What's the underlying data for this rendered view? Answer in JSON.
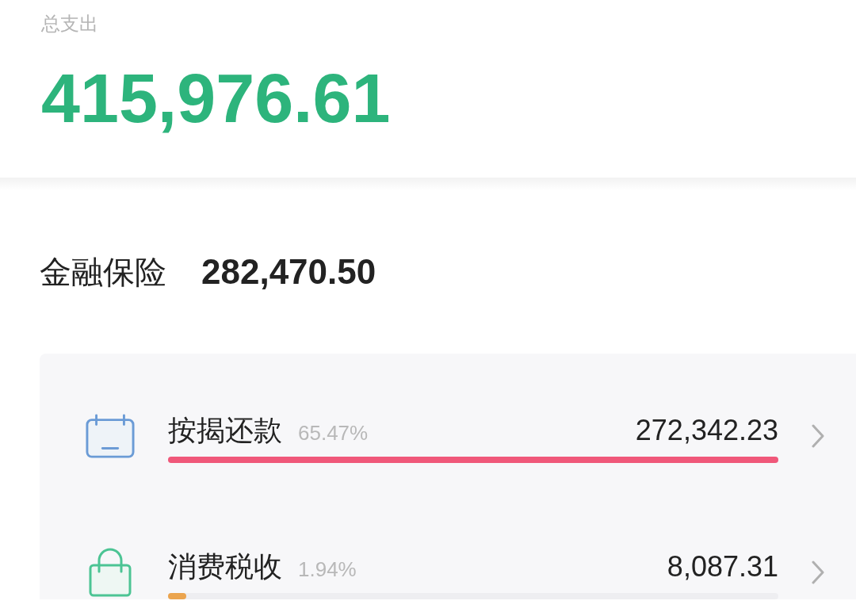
{
  "summary": {
    "label": "总支出",
    "total": "415,976.61"
  },
  "category": {
    "name": "金融保险",
    "amount": "282,470.50"
  },
  "items": [
    {
      "kind": "calendar",
      "name": "按揭还款",
      "percent": "65.47%",
      "amount": "272,342.23",
      "level": 1,
      "color": "#f0587a"
    },
    {
      "kind": "bag",
      "name": "消费税收",
      "percent": "1.94%",
      "amount": "8,087.31",
      "level": 0.03,
      "color": "#eba44e"
    }
  ]
}
